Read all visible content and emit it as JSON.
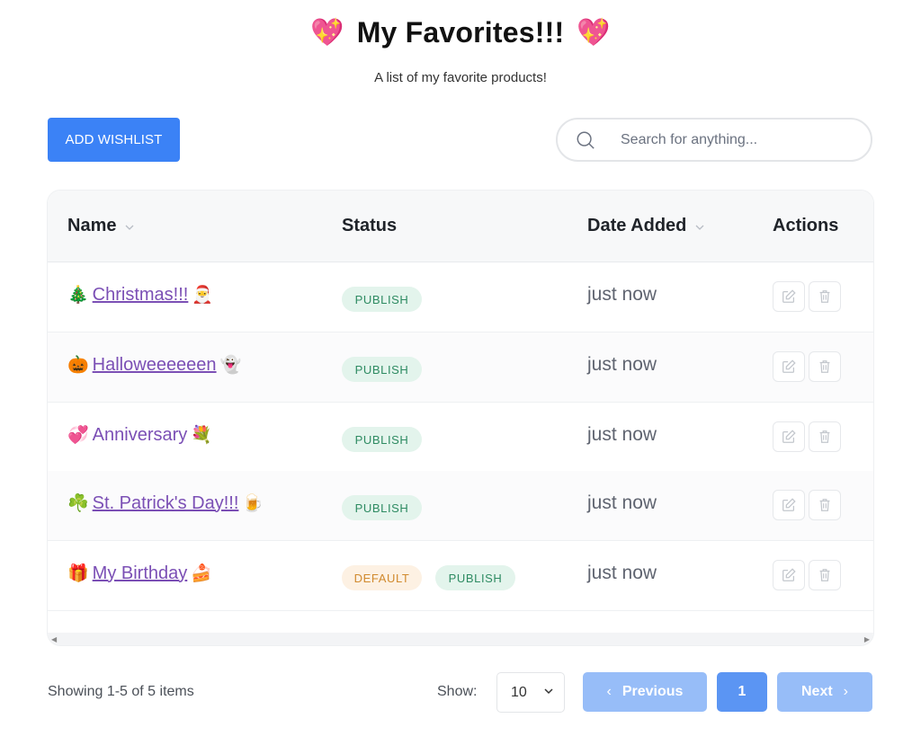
{
  "header": {
    "title": "My Favorites!!!",
    "heart_left": "💖",
    "heart_right": "💖",
    "subtitle": "A list of my favorite products!"
  },
  "toolbar": {
    "add_label": "ADD WISHLIST",
    "search_placeholder": "Search for anything..."
  },
  "table": {
    "columns": {
      "name": "Name",
      "status": "Status",
      "date": "Date Added",
      "actions": "Actions"
    },
    "rows": [
      {
        "emoji_before": "🎄",
        "name": "Christmas!!!",
        "emoji_after": "🎅",
        "underlined": true,
        "badges": [
          "PUBLISH"
        ],
        "date": "just now"
      },
      {
        "emoji_before": "🎃",
        "name": "Halloweeeeeen",
        "emoji_after": "👻",
        "underlined": true,
        "badges": [
          "PUBLISH"
        ],
        "date": "just now"
      },
      {
        "emoji_before": "💞",
        "name": "Anniversary",
        "emoji_after": "💐",
        "underlined": false,
        "badges": [
          "PUBLISH"
        ],
        "date": "just now"
      },
      {
        "emoji_before": "☘️",
        "name": "St. Patrick's Day!!!",
        "emoji_after": "🍺",
        "underlined": true,
        "badges": [
          "PUBLISH"
        ],
        "date": "just now"
      },
      {
        "emoji_before": "🎁",
        "name": "My Birthday",
        "emoji_after": "🍰",
        "underlined": true,
        "badges": [
          "DEFAULT",
          "PUBLISH"
        ],
        "date": "just now"
      }
    ]
  },
  "footer": {
    "showing": "Showing 1-5 of 5 items",
    "show_label": "Show:",
    "show_value": "10",
    "prev_label": "Previous",
    "page": "1",
    "next_label": "Next"
  },
  "colors": {
    "primary": "#3b82f6",
    "link": "#7b4fb5",
    "publish_bg": "#e3f4ec",
    "publish_text": "#2e8b62",
    "default_bg": "#fdf1e3",
    "default_text": "#d18a2e"
  }
}
